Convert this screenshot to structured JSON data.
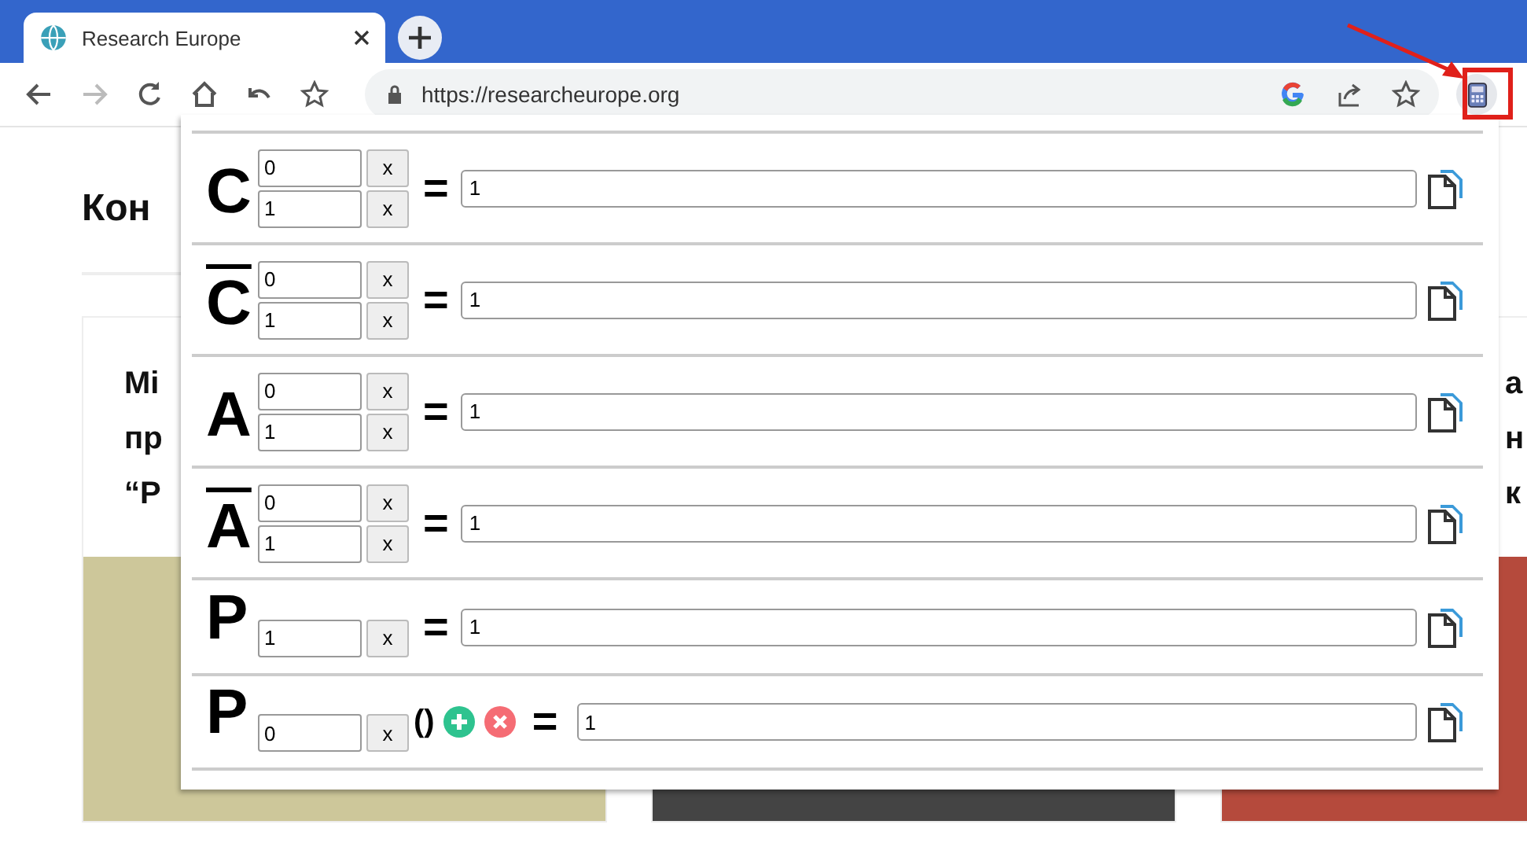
{
  "browser": {
    "tab": {
      "title": "Research Europe",
      "selected": true
    },
    "address": "https://researcheurope.org"
  },
  "page": {
    "heading": "Кон",
    "card_left": [
      "Мі",
      "пр",
      "“Р"
    ],
    "card_right": [
      "а",
      "н",
      "к"
    ]
  },
  "calculator": {
    "rows": [
      {
        "kind": "pair",
        "letter": "C",
        "overline": false,
        "inputs": [
          {
            "value": "0",
            "clear": "x"
          },
          {
            "value": "1",
            "clear": "x"
          }
        ],
        "equals": "=",
        "result": "1"
      },
      {
        "kind": "pair",
        "letter": "C",
        "overline": true,
        "inputs": [
          {
            "value": "0",
            "clear": "x"
          },
          {
            "value": "1",
            "clear": "x"
          }
        ],
        "equals": "=",
        "result": "1"
      },
      {
        "kind": "pair",
        "letter": "A",
        "overline": false,
        "inputs": [
          {
            "value": "0",
            "clear": "x"
          },
          {
            "value": "1",
            "clear": "x"
          }
        ],
        "equals": "=",
        "result": "1"
      },
      {
        "kind": "pair",
        "letter": "A",
        "overline": true,
        "inputs": [
          {
            "value": "0",
            "clear": "x"
          },
          {
            "value": "1",
            "clear": "x"
          }
        ],
        "equals": "=",
        "result": "1"
      },
      {
        "kind": "single",
        "letter": "P",
        "overline": false,
        "inputs": [
          {
            "value": "1",
            "clear": "x"
          }
        ],
        "equals": "=",
        "result": "1"
      },
      {
        "kind": "function",
        "letter": "P",
        "overline": false,
        "inputs": [
          {
            "value": "0",
            "clear": "x"
          }
        ],
        "parens": "()",
        "equals": "=",
        "result": "1"
      }
    ]
  }
}
